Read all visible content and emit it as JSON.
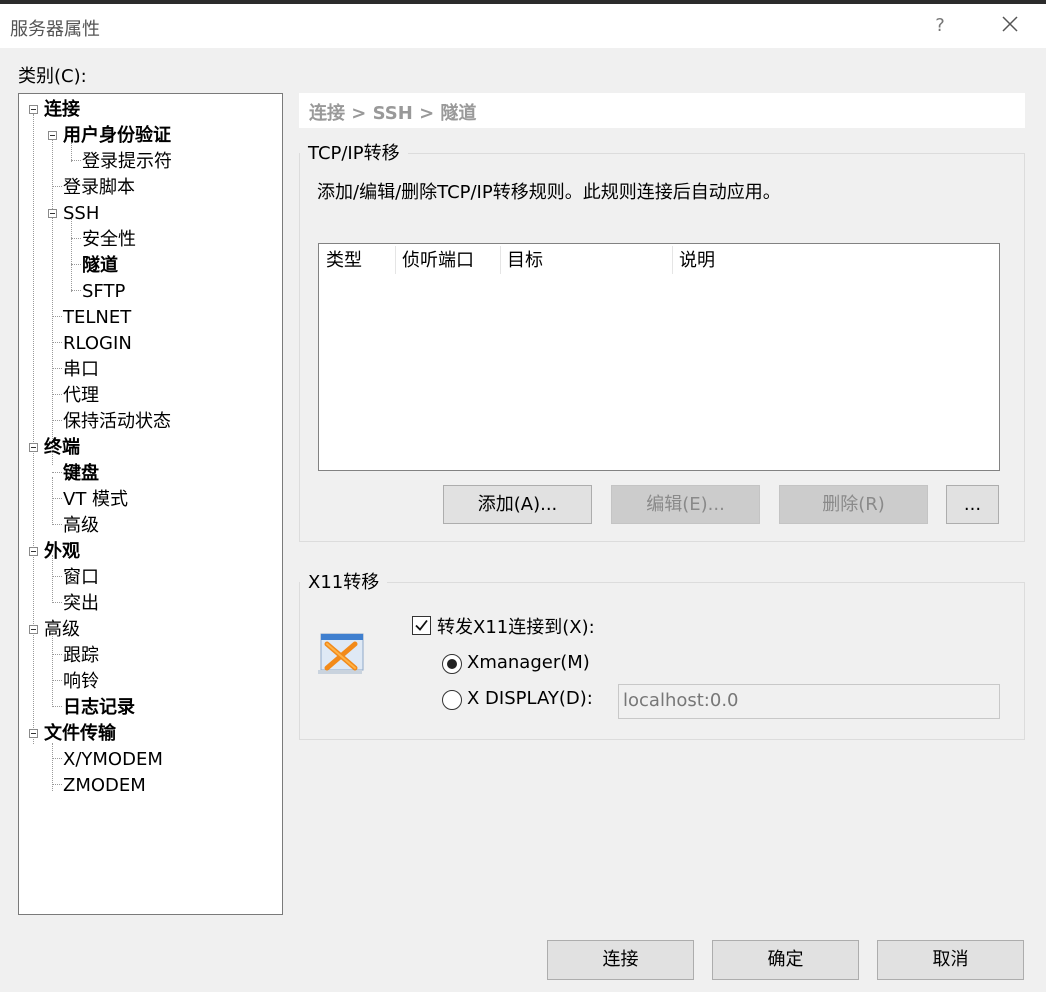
{
  "window": {
    "title": "服务器属性",
    "help_label": "?",
    "close_icon": "close-icon"
  },
  "category_label": "类别(C):",
  "tree": [
    {
      "label": "连接",
      "bold": true
    },
    {
      "label": "用户身份验证",
      "bold": true
    },
    {
      "label": "登录提示符",
      "bold": false
    },
    {
      "label": "登录脚本",
      "bold": false
    },
    {
      "label": "SSH",
      "bold": false
    },
    {
      "label": "安全性",
      "bold": false
    },
    {
      "label": "隧道",
      "bold": true
    },
    {
      "label": "SFTP",
      "bold": false
    },
    {
      "label": "TELNET",
      "bold": false
    },
    {
      "label": "RLOGIN",
      "bold": false
    },
    {
      "label": "串口",
      "bold": false
    },
    {
      "label": "代理",
      "bold": false
    },
    {
      "label": "保持活动状态",
      "bold": false
    },
    {
      "label": "终端",
      "bold": true
    },
    {
      "label": "键盘",
      "bold": true
    },
    {
      "label": "VT 模式",
      "bold": false
    },
    {
      "label": "高级",
      "bold": false
    },
    {
      "label": "外观",
      "bold": true
    },
    {
      "label": "窗口",
      "bold": false
    },
    {
      "label": "突出",
      "bold": false
    },
    {
      "label": "高级",
      "bold": false
    },
    {
      "label": "跟踪",
      "bold": false
    },
    {
      "label": "响铃",
      "bold": false
    },
    {
      "label": "日志记录",
      "bold": true
    },
    {
      "label": "文件传输",
      "bold": true
    },
    {
      "label": "X/YMODEM",
      "bold": false
    },
    {
      "label": "ZMODEM",
      "bold": false
    }
  ],
  "breadcrumb": "连接 > SSH > 隧道",
  "tcp": {
    "title": "TCP/IP转移",
    "description": "添加/编辑/删除TCP/IP转移规则。此规则连接后自动应用。",
    "columns": [
      "类型",
      "侦听端口",
      "目标",
      "说明"
    ],
    "rows": [],
    "add_label": "添加(A)...",
    "edit_label": "编辑(E)...",
    "delete_label": "删除(R)",
    "more_label": "..."
  },
  "x11": {
    "title": "X11转移",
    "forward_label": "转发X11连接到(X):",
    "forward_checked": true,
    "xmanager_label": "Xmanager(M)",
    "xdisplay_label": "X DISPLAY(D):",
    "selected": "Xmanager(M)",
    "display_value": "localhost:0.0",
    "icon": "xmanager-icon"
  },
  "footer": {
    "connect_label": "连接",
    "ok_label": "确定",
    "cancel_label": "取消"
  }
}
